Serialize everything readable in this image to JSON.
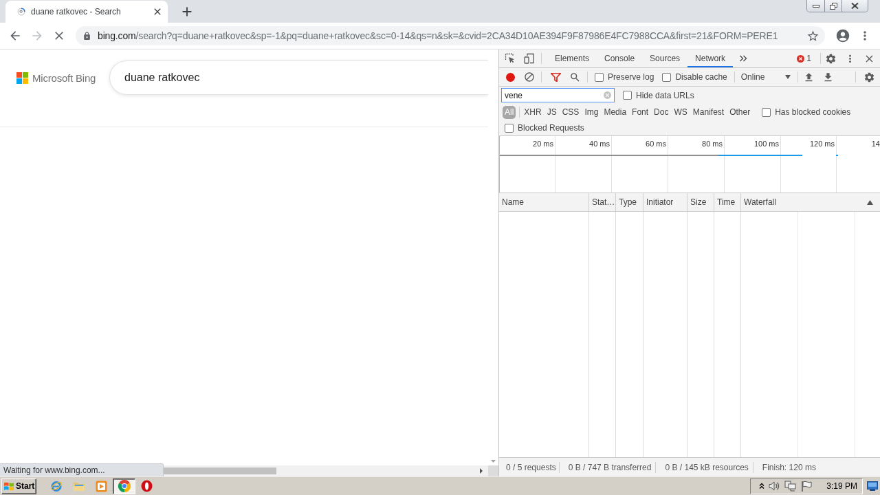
{
  "browser": {
    "tabs": [
      {
        "title": "duane ratkovec - Search",
        "selected": true
      }
    ],
    "loading": true,
    "address": {
      "host": "bing.com",
      "path": "/search?q=duane+ratkovec&sp=-1&pq=duane+ratkovec&sc=0-14&qs=n&sk=&cvid=2CA34D10AE394F9F87986E4FC7988CCA&first=21&FORM=PERE1"
    },
    "status_bubble": "Waiting for www.bing.com..."
  },
  "page": {
    "logo": "Microsoft Bing",
    "search_value": "duane ratkovec"
  },
  "devtools": {
    "panels": [
      {
        "label": "Elements",
        "selected": false
      },
      {
        "label": "Console",
        "selected": false
      },
      {
        "label": "Sources",
        "selected": false
      },
      {
        "label": "Network",
        "selected": true
      }
    ],
    "error_count": "1",
    "recording": true,
    "options": [
      {
        "label": "Preserve log",
        "checked": false
      },
      {
        "label": "Disable cache",
        "checked": false
      }
    ],
    "throttling": "Online",
    "filter": {
      "value": "vene"
    },
    "hide_data_urls": {
      "label": "Hide data URLs",
      "checked": false
    },
    "resource_types": [
      {
        "label": "All",
        "selected": true
      },
      {
        "label": "XHR",
        "selected": false
      },
      {
        "label": "JS",
        "selected": false
      },
      {
        "label": "CSS",
        "selected": false
      },
      {
        "label": "Img",
        "selected": false
      },
      {
        "label": "Media",
        "selected": false
      },
      {
        "label": "Font",
        "selected": false
      },
      {
        "label": "Doc",
        "selected": false
      },
      {
        "label": "WS",
        "selected": false
      },
      {
        "label": "Manifest",
        "selected": false
      },
      {
        "label": "Other",
        "selected": false
      }
    ],
    "has_blocked_cookies": {
      "label": "Has blocked cookies",
      "checked": false
    },
    "blocked_requests": {
      "label": "Blocked Requests",
      "checked": false
    },
    "overview_ticks": [
      "20 ms",
      "40 ms",
      "60 ms",
      "80 ms",
      "100 ms",
      "120 ms",
      "14"
    ],
    "columns": [
      "Name",
      "Stat…",
      "Type",
      "Initiator",
      "Size",
      "Time",
      "Waterfall"
    ],
    "summary": [
      "0 / 5 requests",
      "0 B / 747 B transferred",
      "0 B / 145 kB resources",
      "Finish: 120 ms"
    ]
  },
  "taskbar": {
    "start": "Start",
    "apps": [
      {
        "kind": "ie",
        "selected": false
      },
      {
        "kind": "folder",
        "selected": false
      },
      {
        "kind": "media",
        "selected": false
      },
      {
        "kind": "chrome",
        "selected": true
      },
      {
        "kind": "ring",
        "selected": false
      }
    ],
    "clock": "3:19 PM"
  }
}
